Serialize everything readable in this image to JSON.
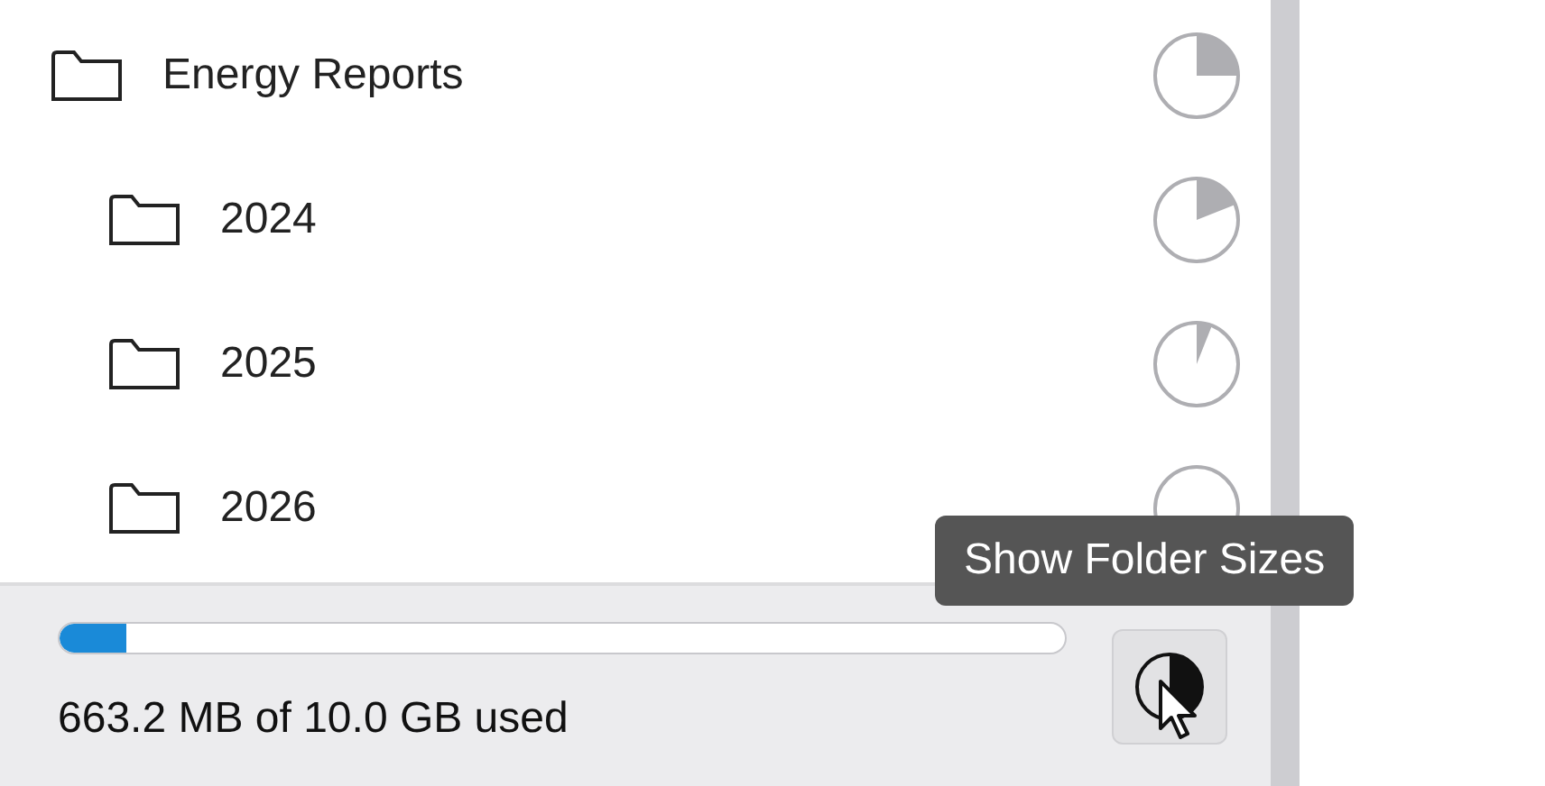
{
  "tree": [
    {
      "name": "Energy Reports",
      "children": [
        {
          "name": "2024"
        },
        {
          "name": "2025"
        },
        {
          "name": "2026"
        }
      ]
    }
  ],
  "storage": {
    "level": 0.066,
    "reading": "663.2 MB of 10.0 GB used"
  },
  "tooltip": "Show Folder Sizes"
}
